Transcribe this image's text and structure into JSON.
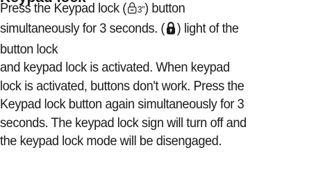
{
  "heading": "Keypad lock",
  "paragraph1": {
    "line1_before_icon": "Press the Keypad lock (",
    "icon_label": "3\"",
    "line1_after_icon": ") button",
    "line2_before_icon": "simultaneously for 3 seconds. (",
    "line2_after_icon": ") light of the",
    "line3": "button lock"
  },
  "paragraph2": {
    "line1": "and keypad lock is activated. When keypad",
    "line2": "lock is activated, buttons don't work. Press the",
    "line3": "Keypad lock button again simultaneously for 3",
    "line4": "seconds. The keypad lock sign will turn off and",
    "line5": "the keypad lock mode will be disengaged."
  },
  "icons": {
    "keypad_lock_symbol": "keypad-lock-icon",
    "lock_light_symbol": "lock-icon"
  }
}
